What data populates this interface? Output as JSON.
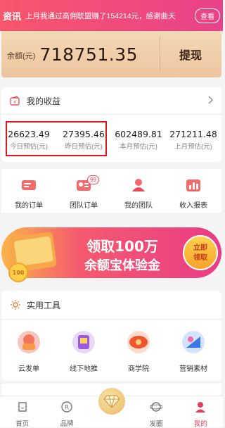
{
  "news": {
    "tag": "资讯",
    "text": "上月我通过高佣联盟赚了154214元，感谢曲天",
    "view_label": "查看"
  },
  "balance": {
    "label": "余额(元)",
    "value": "718751.35",
    "withdraw_label": "提现"
  },
  "earnings": {
    "title": "我的收益",
    "items": [
      {
        "value": "26623.49",
        "label": "今日预估(元)"
      },
      {
        "value": "27395.46",
        "label": "昨日预估(元)"
      },
      {
        "value": "602489.81",
        "label": "本月预估(元)"
      },
      {
        "value": "271211.48",
        "label": "上月预估(元)"
      }
    ]
  },
  "menu": {
    "items": [
      {
        "label": "我的订单",
        "icon": "order-icon"
      },
      {
        "label": "团队订单",
        "icon": "team-order-icon",
        "badge": "99"
      },
      {
        "label": "我的团队",
        "icon": "team-icon"
      },
      {
        "label": "收入报表",
        "icon": "report-icon"
      }
    ]
  },
  "banner": {
    "text_line1": "领取100万",
    "text_line2": "余额宝体验金",
    "button_line1": "立即",
    "button_line2": "领取",
    "coin_text": "100"
  },
  "tools": {
    "title": "实用工具",
    "items": [
      {
        "label": "云发单",
        "icon": "cloud-publish-icon"
      },
      {
        "label": "线下地推",
        "icon": "offline-promo-icon"
      },
      {
        "label": "商学院",
        "icon": "academy-icon"
      },
      {
        "label": "营销素材",
        "icon": "marketing-material-icon"
      }
    ]
  },
  "tabs": {
    "items": [
      {
        "label": "首页",
        "icon": "home-icon"
      },
      {
        "label": "品牌",
        "icon": "brand-icon"
      },
      {
        "label": "",
        "icon": "diamond-icon"
      },
      {
        "label": "发圈",
        "icon": "moments-icon"
      },
      {
        "label": "我的",
        "icon": "profile-icon",
        "active": true
      }
    ]
  },
  "colors": {
    "brand_gradient_start": "#f7566c",
    "brand_gradient_end": "#e8428a",
    "balance_card": "#edc59e",
    "highlight_box": "#e0141e",
    "active_tab": "#e83e5a"
  }
}
